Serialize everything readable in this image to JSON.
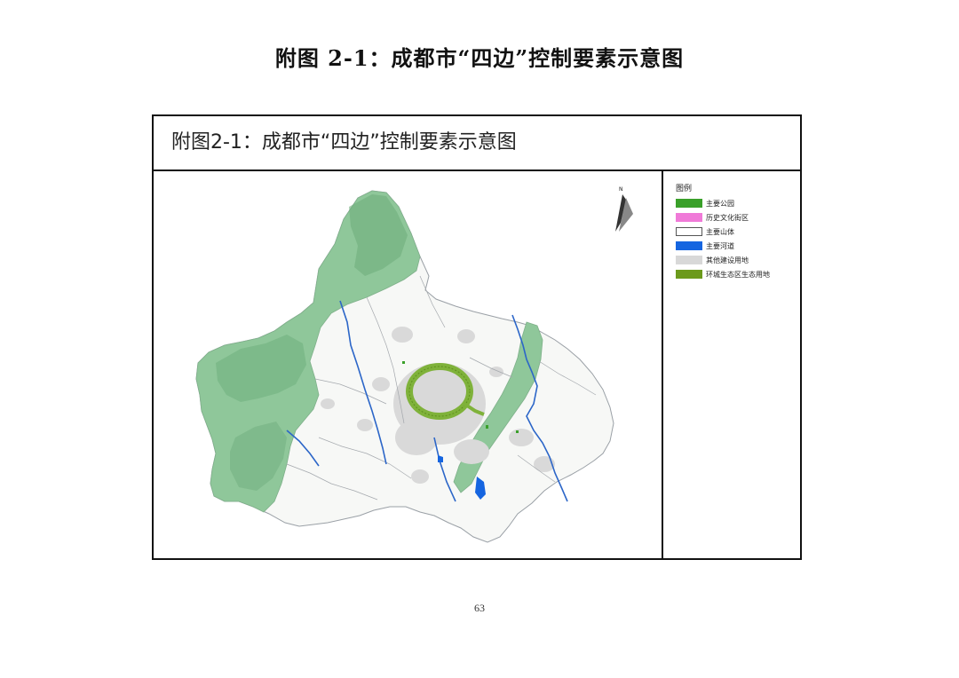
{
  "page": {
    "heading": "附图 2-1：成都市“四边”控制要素示意图",
    "page_number": "63"
  },
  "figure": {
    "title": "附图2-1：成都市“四边”控制要素示意图",
    "north_label": "N"
  },
  "legend": {
    "title": "图例",
    "items": [
      {
        "label": "主要公园",
        "color": "#3aa02a"
      },
      {
        "label": "历史文化街区",
        "color": "#f07ad8"
      },
      {
        "label": "主要山体",
        "color": "#ffffff"
      },
      {
        "label": "主要河道",
        "color": "#1565e0"
      },
      {
        "label": "其他建设用地",
        "color": "#d8d8d8"
      },
      {
        "label": "环城生态区生态用地",
        "color": "#6c9a1c"
      }
    ]
  },
  "map_colors": {
    "mountain": "#8fc79a",
    "mountain_dark": "#6fae7d",
    "river": "#2c66c8",
    "built_up": "#d9d9d9",
    "ring_park": "#7fb23a",
    "border": "#9aa0a6"
  }
}
